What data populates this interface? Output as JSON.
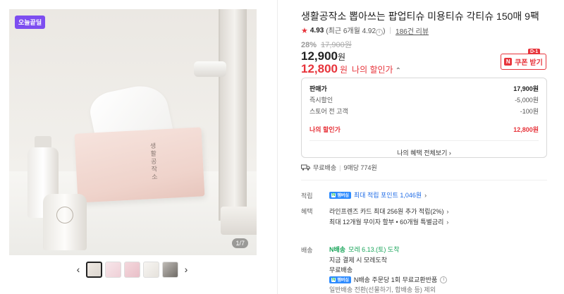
{
  "gallery": {
    "badge": "오늘끝딜",
    "counter": "1/7",
    "box_label": "생활공작소",
    "prev": "‹",
    "next": "›"
  },
  "product": {
    "title": "생활공작소 뽑아쓰는 팝업티슈 미용티슈 각티슈 150매 9팩",
    "rating": "4.93",
    "rating_recent": "(최근 6개월 4.92",
    "rating_recent_close": ")",
    "info_glyph": "i",
    "review_count": "186건 리뷰",
    "discount_rate": "28%",
    "original_price": "17,900원",
    "price": "12,900",
    "price_unit": "원",
    "my_price": "12,800",
    "my_price_unit": "원",
    "my_price_note": "나의 할인가",
    "my_price_chevron": "⌃"
  },
  "coupon": {
    "tag": "D-1",
    "icon": "N",
    "label": "쿠폰 받기"
  },
  "price_breakdown": {
    "rows": [
      {
        "label": "판매가",
        "value": "17,900원"
      },
      {
        "label": "즉시할인",
        "value": "-5,000원"
      },
      {
        "label": "스토어 전 고객",
        "value": "-100원"
      }
    ],
    "final_label": "나의 할인가",
    "final_value": "12,800원",
    "more": "나의 혜택 전체보기 ›"
  },
  "shipping_summary": {
    "free": "무료배송",
    "per_pack": "9매당 774원"
  },
  "points": {
    "label": "적립",
    "badge_n": "N",
    "badge_text": "멤버십",
    "text": "최대 적립 포인트 1,046원",
    "chevron": "›"
  },
  "benefits": {
    "label": "혜택",
    "line1": "라인프렌즈 카드 최대 256원 추가 적립(2%)",
    "line1_chevron": "›",
    "line2": "최대 12개월 무이자 할부 • 60개월 특별금리",
    "line2_chevron": "›"
  },
  "delivery": {
    "label": "배송",
    "badge_n": "N",
    "badge_text": "배송",
    "date": "모레 6.13.(토) 도착",
    "line2": "지금 결제 시 모레도착",
    "line3": "무료배송",
    "membership_n": "N",
    "membership_text": "멤버십",
    "line4": "N배송 주문당 1회 무료교환반품",
    "info_glyph": "i",
    "line5": "일반배송 전환(선물하기, 합배송 등) 제외"
  },
  "colors": {
    "accent_red": "#e7343b",
    "badge_purple": "#7d4df0",
    "link_blue": "#1e6be6",
    "npay_green": "#19a55a"
  }
}
